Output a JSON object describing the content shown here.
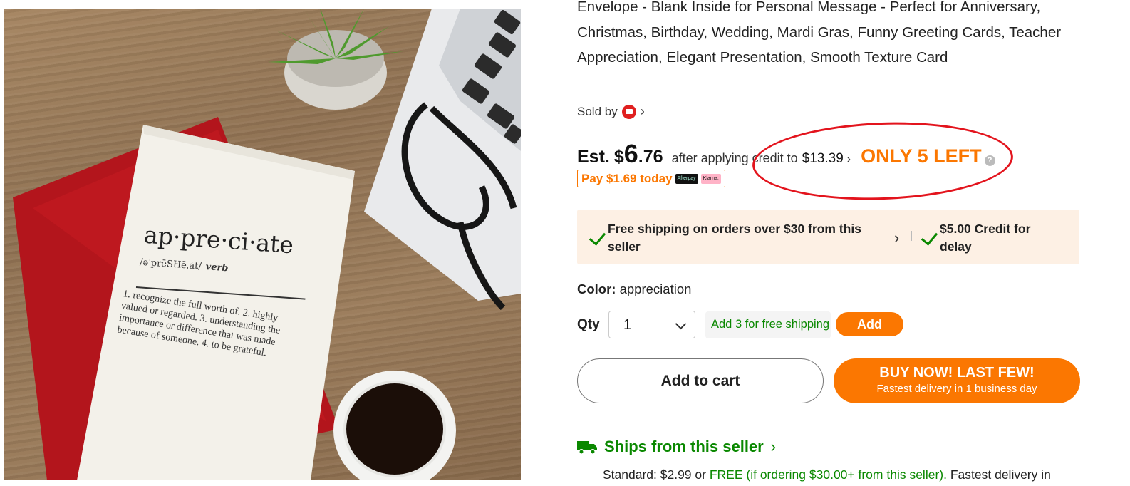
{
  "product": {
    "title": "Envelope - Blank Inside for Personal Message - Perfect for Anniversary, Christmas, Birthday, Wedding, Mardi Gras, Funny Greeting Cards, Teacher Appreciation, Elegant Presentation, Smooth Texture Card",
    "sold_by": "Sold by",
    "image_text": {
      "word": "ap·pre·ci·ate",
      "pronunciation": "/əˈprēSHēˌāt/",
      "part_of_speech": "verb",
      "definition": "1. recognize the full worth of. 2. highly valued or regarded. 3. understanding the importance or difference that was made because of someone. 4. to be grateful."
    }
  },
  "price": {
    "est_label": "Est.",
    "currency": "$",
    "whole": "6",
    "cents": ".76",
    "after_text": "after applying credit to",
    "original": "$13.39",
    "stock_text": "ONLY 5 LEFT",
    "help_icon": "?",
    "pay_today": "Pay $1.69 today",
    "bnpl_logos": [
      "Afterpay",
      "Klarna."
    ]
  },
  "shipping_promo": {
    "free_shipping": "Free shipping on orders over $30 from this seller",
    "credit_delay": "$5.00 Credit for delay"
  },
  "color": {
    "label": "Color:",
    "value": "appreciation"
  },
  "quantity": {
    "label": "Qty",
    "value": "1"
  },
  "free_ship_hint": {
    "text": "Add 3 for free shipping",
    "button": "Add"
  },
  "buttons": {
    "add_to_cart": "Add to cart",
    "buy_now": "BUY NOW! LAST FEW!",
    "buy_now_sub": "Fastest delivery in 1 business day"
  },
  "ships_from": {
    "label": "Ships from this seller",
    "standard_prefix": "Standard: $2.99 or",
    "standard_free": "FREE (if ordering $30.00+ from this seller).",
    "standard_suffix": "Fastest delivery in"
  },
  "colors": {
    "accent_orange": "#fb7701",
    "green": "#0a8800",
    "annotation_red": "#e3141d",
    "promo_bg": "#fdf0e4"
  }
}
